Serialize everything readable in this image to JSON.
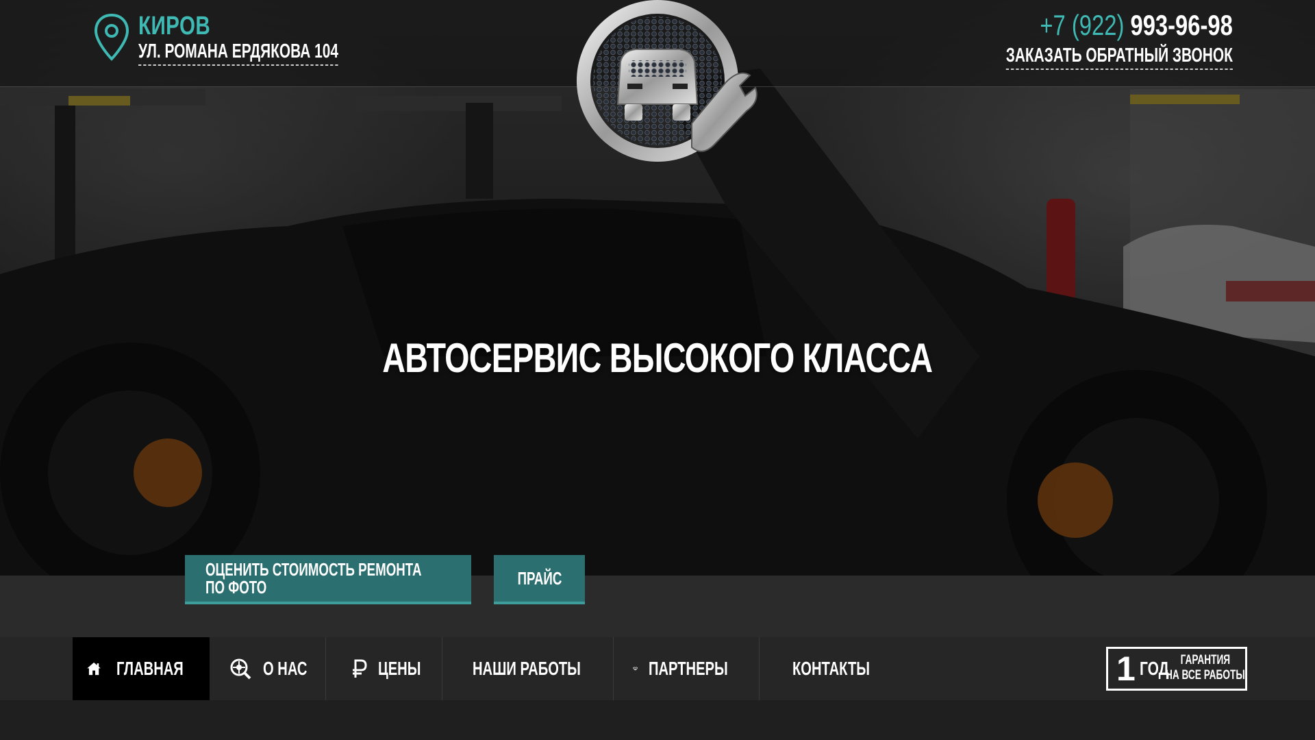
{
  "header": {
    "city": "КИРОВ",
    "address": "УЛ. РОМАНА ЕРДЯКОВА 104",
    "phone_code": "+7 (922)",
    "phone_number": "993-96-98",
    "callback_label": "ЗАКАЗАТЬ ОБРАТНЫЙ ЗВОНОК",
    "accent_color": "#3fb9b3"
  },
  "hero": {
    "headline": "АВТОСЕРВИС ВЫСОКОГО КЛАССА",
    "buttons": {
      "photo_estimate_line1": "ОЦЕНИТЬ СТОИМОСТЬ РЕМОНТА",
      "photo_estimate_line2": "ПО ФОТО",
      "price": "ПРАЙС"
    },
    "button_color": "#2c6f70"
  },
  "nav": {
    "items": [
      {
        "label": "ГЛАВНАЯ",
        "icon": "home-icon",
        "active": true
      },
      {
        "label": "О НАС",
        "icon": "wheel-search-icon",
        "active": false
      },
      {
        "label": "ЦЕНЫ",
        "icon": "ruble-icon",
        "active": false
      },
      {
        "label": "НАШИ РАБОТЫ",
        "icon": "mechanic-icon",
        "active": false
      },
      {
        "label": "ПАРТНЕРЫ",
        "icon": "handshake-icon",
        "active": false
      },
      {
        "label": "КОНТАКТЫ",
        "icon": "location-pin-icon",
        "active": false
      }
    ]
  },
  "guarantee": {
    "number": "1",
    "unit": "ГОД",
    "line1": "ГАРАНТИЯ",
    "line2": "НА ВСЕ РАБОТЫ"
  }
}
